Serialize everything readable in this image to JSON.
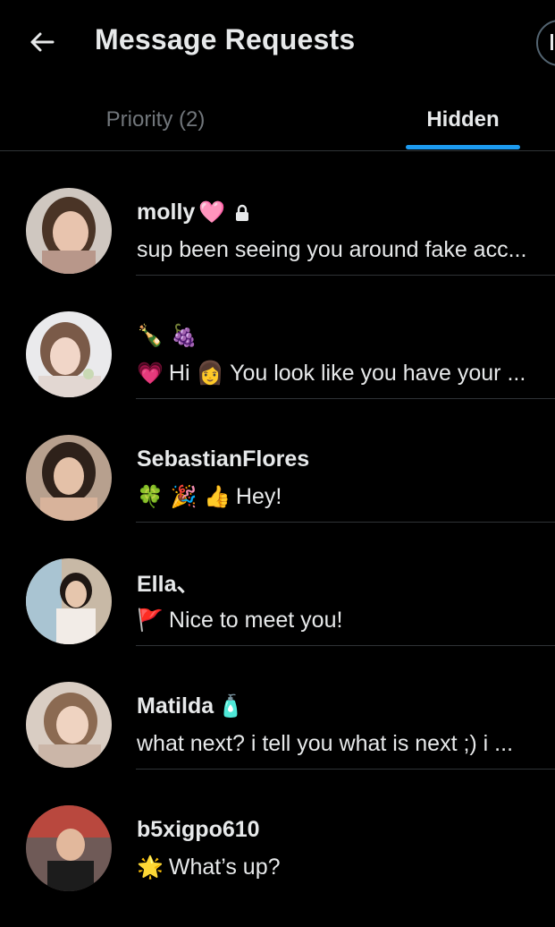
{
  "header": {
    "title": "Message Requests"
  },
  "tabs": [
    {
      "label": "Priority (2)",
      "active": false
    },
    {
      "label": "Hidden",
      "active": true
    }
  ],
  "colors": {
    "accent": "#1d9bf0",
    "background": "#000000",
    "text": "#e7e9ea",
    "muted": "#71767b",
    "divider": "#2f3336"
  },
  "messages": [
    {
      "name": "molly",
      "name_emoji": "🩷",
      "verified_lock": true,
      "preview_emoji": "",
      "preview": "sup been seeing you around fake acc..."
    },
    {
      "name": "🍾 🍇",
      "name_emoji": "",
      "verified_lock": false,
      "preview_emoji": "💗",
      "preview": "Hi 👩 You look like you have your ..."
    },
    {
      "name": "SebastianFlores",
      "name_emoji": "",
      "verified_lock": false,
      "preview_emoji": "🍀 🎉 👍",
      "preview": "Hey!"
    },
    {
      "name": "Ella、",
      "name_emoji": "",
      "verified_lock": false,
      "preview_emoji": "🚩",
      "preview": "Nice to meet you!"
    },
    {
      "name": "Matilda",
      "name_emoji": "🧴",
      "verified_lock": false,
      "preview_emoji": "",
      "preview": "what next? i tell you what is next ;) i ..."
    },
    {
      "name": "b5xigpo610",
      "name_emoji": "",
      "verified_lock": false,
      "preview_emoji": "🌟",
      "preview": "What’s up?"
    }
  ]
}
